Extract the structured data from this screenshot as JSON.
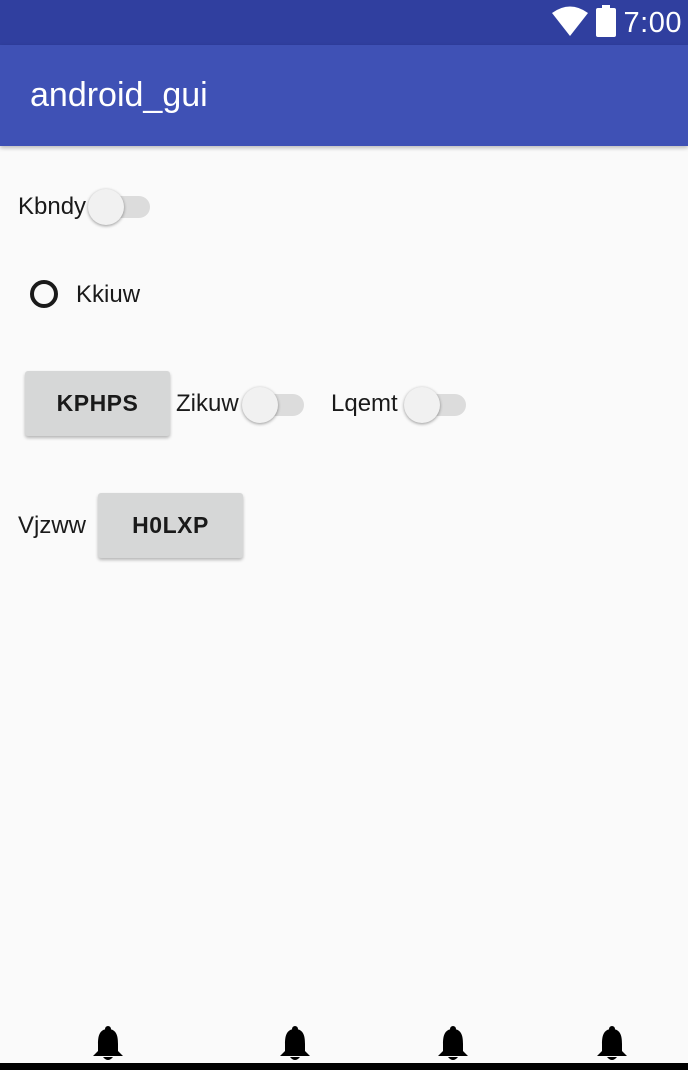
{
  "status_bar": {
    "time": "7:00",
    "icons": [
      "wifi-icon",
      "battery-icon"
    ]
  },
  "app_bar": {
    "title": "android_gui"
  },
  "form": {
    "row1": {
      "switch_label": "Kbndy",
      "switch_on": false
    },
    "row2": {
      "radio_label": "Kkiuw",
      "radio_checked": false
    },
    "row3": {
      "button_label": "KPHPS",
      "switch1_label": "Zikuw",
      "switch1_on": false,
      "switch2_label": "Lqemt",
      "switch2_on": false
    },
    "row4": {
      "label": "Vjzww",
      "button_label": "H0LXP"
    }
  },
  "bottom_nav": {
    "icons": [
      "bell-icon",
      "bell-icon",
      "bell-icon",
      "bell-icon"
    ]
  },
  "colors": {
    "status_bar": "#303f9f",
    "app_bar": "#3f51b5",
    "background": "#fafafa",
    "button": "#d6d7d7"
  }
}
